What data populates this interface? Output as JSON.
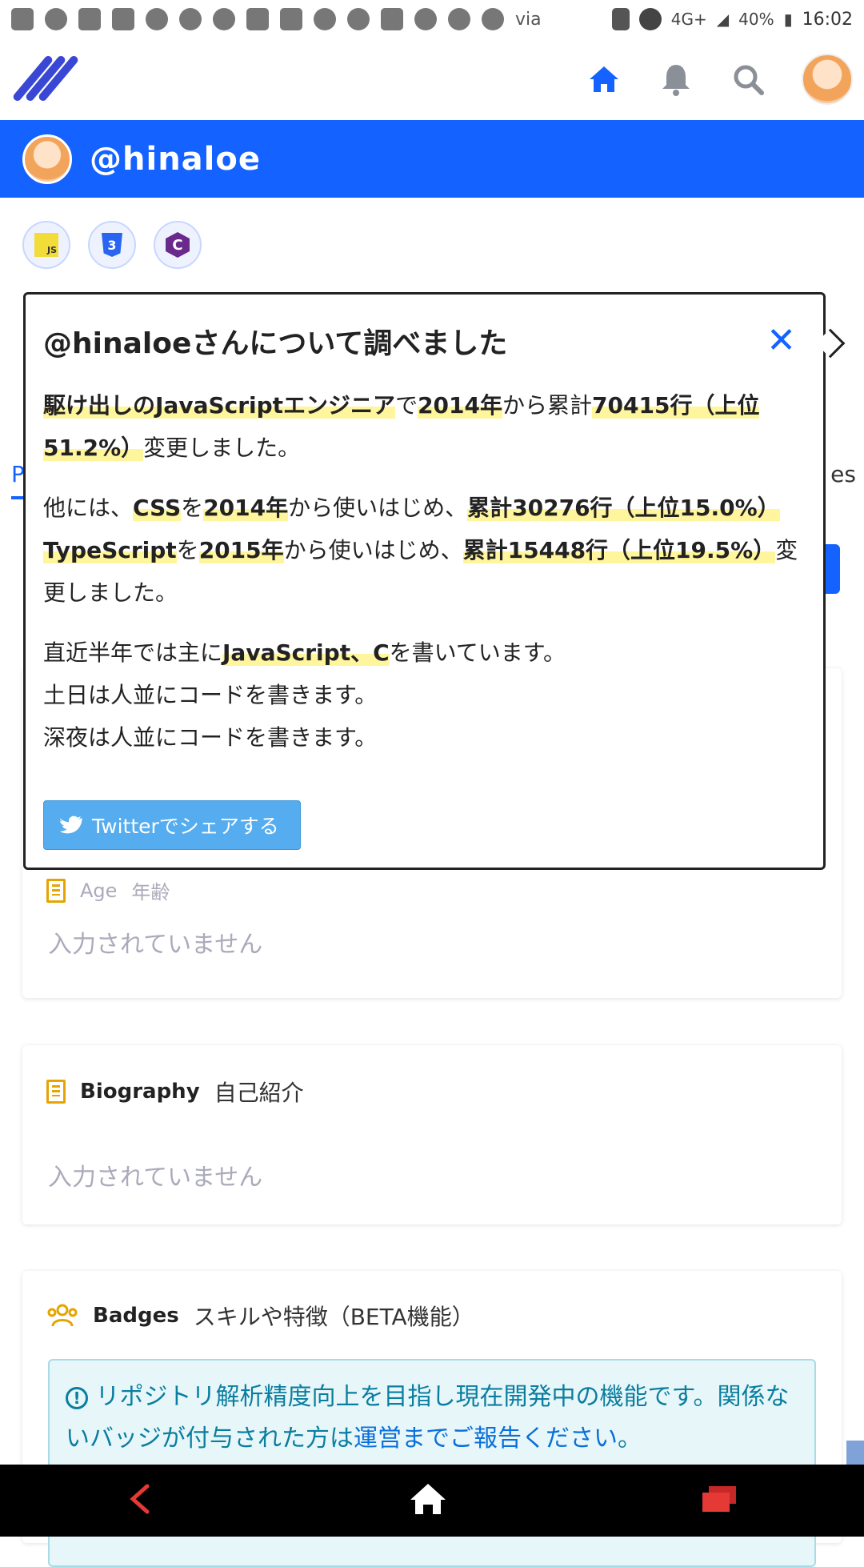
{
  "status_bar": {
    "via": "via",
    "network": "4G+",
    "battery": "40%",
    "time": "16:02"
  },
  "header": {
    "username": "@hinaloe"
  },
  "background": {
    "tab_left": "P",
    "tab_right": "es",
    "age_label_en": "Age",
    "age_label_ja": "年齢",
    "age_value": "入力されていません",
    "bio_label_en": "Biography",
    "bio_label_ja": "自己紹介",
    "bio_value": "入力されていません",
    "badges_label_en": "Badges",
    "badges_label_ja": "スキルや特徴（BETA機能）",
    "alert_text": "リポジトリ解析精度向上を目指し現在開発中の機能です。関係ないバッジが付与された方は",
    "alert_link": "運営までご報告ください",
    "alert_end": "。"
  },
  "popup": {
    "title": "@hinaloeさんについて調べました",
    "p1": {
      "role": "駆け出しのJavaScriptエンジニア",
      "t1": "で",
      "year": "2014年",
      "t2": "から累計",
      "lines": "70415行（上位51.2%）",
      "t3": "変更しました。"
    },
    "p2": {
      "t1": "他には、",
      "lang1": "CSS",
      "t2": "を",
      "year1": "2014年",
      "t3": "から使いはじめ、",
      "lines1": "累計30276行（上位15.0%）",
      "lang2": "TypeScript",
      "t4": "を",
      "year2": "2015年",
      "t5": "から使いはじめ、",
      "lines2": "累計15448行（上位19.5%）",
      "t6": "変更しました。"
    },
    "p3": {
      "t1": "直近半年では主に",
      "langs": "JavaScript、C",
      "t2": "を書いています。",
      "line2": "土日は人並にコードを書きます。",
      "line3": "深夜は人並にコードを書きます。"
    },
    "share_button": "Twitterでシェアする"
  },
  "icons": {
    "js": "JS",
    "css3": "3",
    "c": "C"
  },
  "colors": {
    "brand_blue": "#1462ff",
    "highlight": "#fff59d",
    "twitter": "#55acee",
    "alert_text": "#0a7ea0"
  }
}
